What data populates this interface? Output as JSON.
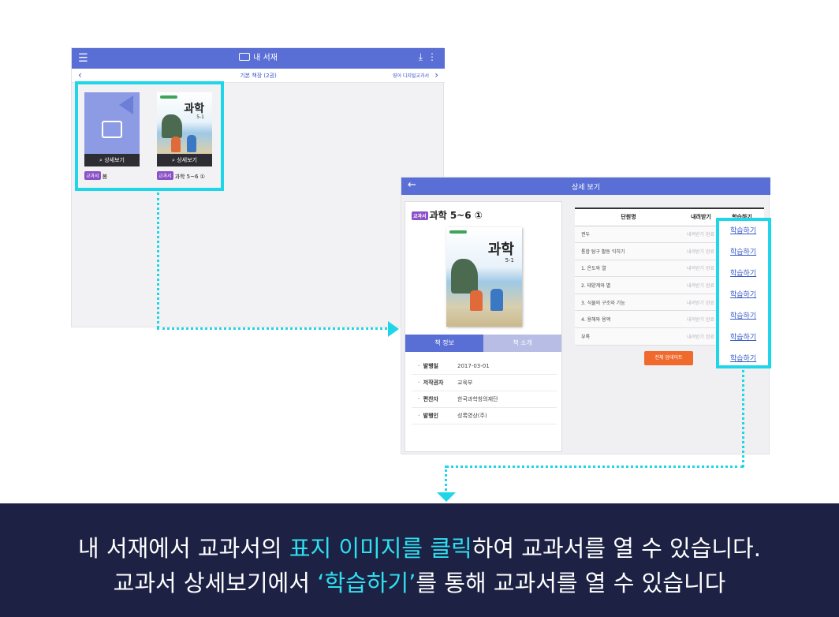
{
  "library": {
    "title": "내 서재",
    "shelf_label": "기본 책장 (2권)",
    "english_link": "영어 디지털교과서",
    "books": [
      {
        "badge": "교과서",
        "name": "봄",
        "detail_label": "상세보기"
      },
      {
        "badge": "교과서",
        "name": "과학 5~6 ①",
        "detail_label": "상세보기"
      }
    ]
  },
  "cover": {
    "title": "과학",
    "grade": "5-1"
  },
  "detail": {
    "title": "상세 보기",
    "badge": "교과서",
    "book_name": "과학 5~6 ①",
    "tabs": [
      "책 정보",
      "책 소개"
    ],
    "info": [
      {
        "key": "발행일",
        "value": "2017-03-01"
      },
      {
        "key": "저작권자",
        "value": "교육부"
      },
      {
        "key": "편찬자",
        "value": "한국과학창의재단"
      },
      {
        "key": "발행인",
        "value": "성록영상(주)"
      }
    ],
    "table_headers": [
      "단원명",
      "내려받기",
      "학습하기"
    ],
    "units": [
      {
        "name": "권두",
        "download": "내려받기 완료"
      },
      {
        "name": "통합 탐구 활동 익히기",
        "download": "내려받기 완료"
      },
      {
        "name": "1. 온도와 열",
        "download": "내려받기 완료"
      },
      {
        "name": "2. 태양계와 별",
        "download": "내려받기 완료"
      },
      {
        "name": "3. 식물의 구조와 기능",
        "download": "내려받기 완료"
      },
      {
        "name": "4. 용해와 용액",
        "download": "내려받기 완료"
      },
      {
        "name": "부록",
        "download": "내려받기 완료"
      }
    ],
    "study_label": "학습하기",
    "update_all": "전체 업데이트"
  },
  "caption": {
    "line1_a": "내 서재에서 교과서의 ",
    "line1_hi": "표지 이미지를 클릭",
    "line1_b": "하여 교과서를 열 수 있습니다.",
    "line2_a": "교과서 상세보기에서 ",
    "line2_hi": "‘학습하기’",
    "line2_b": "를 통해 교과서를 열 수 있습니다"
  },
  "colors": {
    "appbar": "#5a6fd6",
    "highlight": "#1fd6e8",
    "caption_bg": "#1d2245",
    "badge": "#8a52c6",
    "update_button": "#f06a2e"
  }
}
